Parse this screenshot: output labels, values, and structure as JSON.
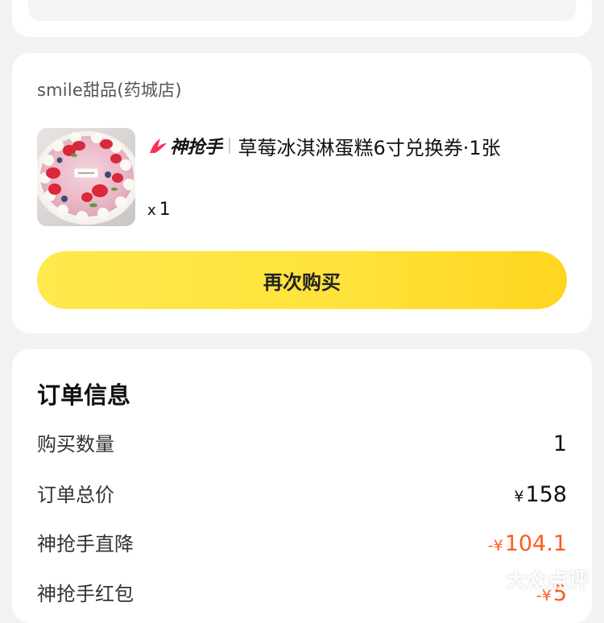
{
  "order_detail": {
    "store_name": "smile甜品(药城店)",
    "product": {
      "image": "strawberry-cake-photo",
      "brand_tag": "神抢手",
      "title": "草莓冰淇淋蛋糕6寸兑换券·1张",
      "quantity_prefix": "x",
      "quantity": "1"
    },
    "buy_again_label": "再次购买",
    "order_info": {
      "heading": "订单信息",
      "rows": [
        {
          "label": "购买数量",
          "currency": "",
          "sign": "",
          "value": "1"
        },
        {
          "label": "订单总价",
          "currency": "¥",
          "sign": "",
          "value": "158"
        },
        {
          "label": "神抢手直降",
          "currency": "¥",
          "sign": "-",
          "value": "104.1"
        },
        {
          "label": "神抢手红包",
          "currency": "¥",
          "sign": "-",
          "value": "5"
        }
      ]
    },
    "watermark": "大众点评",
    "colors": {
      "button_yellow": "#ffe23a",
      "discount_red": "#ff5a1f",
      "brand_red": "#ff2d55",
      "page_bg": "#f2f2f2"
    }
  }
}
